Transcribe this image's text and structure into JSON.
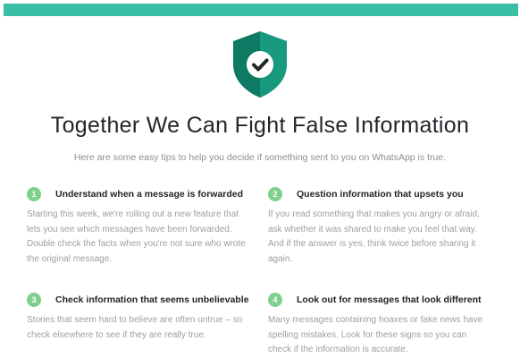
{
  "colors": {
    "accent": "#3bbfa4",
    "shield_dark": "#0e7a63",
    "shield_light": "#16997c",
    "badge": "#7fd08c"
  },
  "header": {
    "icon": "shield-check-icon",
    "title": "Together We Can Fight False Information",
    "subtitle": "Here are some easy tips to help you decide if something sent to you on WhatsApp is true."
  },
  "tips": [
    {
      "number": "1",
      "title": "Understand when a message is forwarded",
      "body": "Starting this week, we're rolling out a new feature that lets you see which messages have been forwarded. Double check the facts when you're not sure who wrote the original message."
    },
    {
      "number": "2",
      "title": "Question information that upsets you",
      "body": "If you read something that makes you angry or afraid, ask whether it was shared to make you feel that way. And if the answer is yes, think twice before sharing it again."
    },
    {
      "number": "3",
      "title": "Check information that seems unbelievable",
      "body": "Stories that seem hard to believe are often untrue – so check elsewhere to see if they are really true."
    },
    {
      "number": "4",
      "title": "Look out for messages that look different",
      "body": "Many messages containing hoaxes or fake news have spelling mistakes. Look for these signs so you can check if the information is accurate."
    }
  ]
}
